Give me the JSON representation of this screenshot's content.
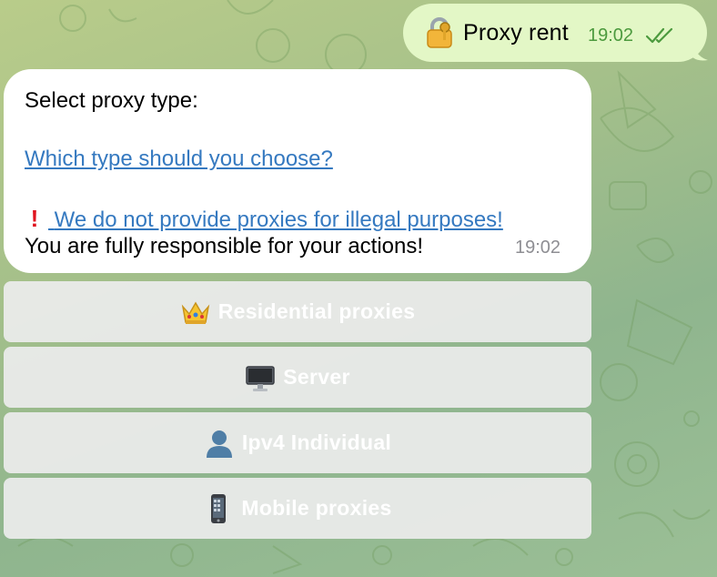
{
  "outgoing": {
    "icon": "locked-with-key-icon",
    "text": "Proxy rent",
    "time": "19:02",
    "status_icon": "double-check-icon"
  },
  "incoming": {
    "line1": "Select proxy type:",
    "link1": "Which type should you choose?",
    "warning_icon": "exclamation-icon",
    "link2": "We do not provide proxies for illegal purposes!",
    "line2": "You are fully responsible for your actions!",
    "time": "19:02"
  },
  "keyboard": {
    "buttons": [
      {
        "icon": "crown-icon",
        "label": "Residential proxies"
      },
      {
        "icon": "desktop-computer-icon",
        "label": "Server"
      },
      {
        "icon": "person-silhouette-icon",
        "label": "Ipv4 Individual"
      },
      {
        "icon": "mobile-phone-icon",
        "label": "Mobile proxies"
      }
    ]
  },
  "colors": {
    "outgoing_bubble": "#e3f7c6",
    "incoming_bubble": "#ffffff",
    "link": "#3579c0",
    "time_out": "#4c9a3e",
    "button_bg": "#ececec"
  }
}
